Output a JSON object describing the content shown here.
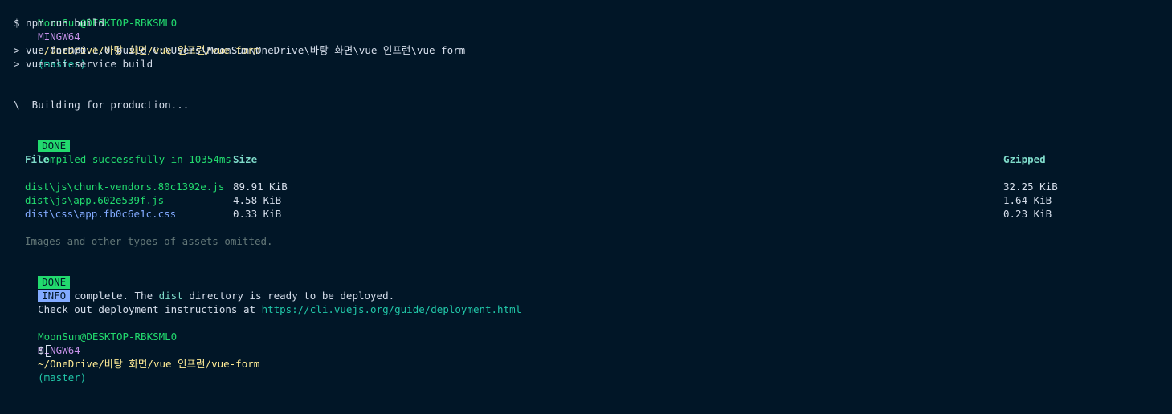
{
  "prompt1": {
    "user_host": "MoonSun@DESKTOP-RBKSML0",
    "env": "MINGW64",
    "path": "~/OneDrive/바탕 화면/vue 인프런/vue-form",
    "branch": "(master)"
  },
  "command": "$ npm run build",
  "script_line1": "> vue-form@0.1.0 build C:\\Users\\MoonSun\\OneDrive\\바탕 화면\\vue 인프런\\vue-form",
  "script_line2": "> vue-cli-service build",
  "spinner": "\\  Building for production...",
  "compile": {
    "badge": "DONE",
    "message": "Compiled successfully in 10354ms"
  },
  "table": {
    "headers": {
      "file": "File",
      "size": "Size",
      "gzipped": "Gzipped"
    },
    "rows": [
      {
        "file": "dist\\js\\chunk-vendors.80c1392e.js",
        "size": "89.91 KiB",
        "gzipped": "32.25 KiB",
        "color": "#22da6e"
      },
      {
        "file": "dist\\js\\app.602e539f.js",
        "size": "4.58 KiB",
        "gzipped": "1.64 KiB",
        "color": "#22da6e"
      },
      {
        "file": "dist\\css\\app.fb0c6e1c.css",
        "size": "0.33 KiB",
        "gzipped": "0.23 KiB",
        "color": "#82aaff"
      }
    ]
  },
  "omitted_note": "Images and other types of assets omitted.",
  "build_complete": {
    "badge": "DONE",
    "text_before": "Build complete. The ",
    "dist": "dist",
    "text_after": " directory is ready to be deployed."
  },
  "info": {
    "badge": "INFO",
    "text": "Check out deployment instructions at ",
    "url": "https://cli.vuejs.org/guide/deployment.html"
  },
  "prompt2": {
    "user_host": "MoonSun@DESKTOP-RBKSML0",
    "env": "MINGW64",
    "path": "~/OneDrive/바탕 화면/vue 인프런/vue-form",
    "branch": "(master)"
  },
  "final_prompt": "$",
  "colors": {
    "background": "#011627",
    "foreground": "#d6deeb",
    "green": "#22da6e",
    "purple": "#c792ea",
    "yellow": "#ffeb95",
    "teal": "#21c7a8",
    "blue": "#82aaff",
    "grey": "#637777"
  }
}
